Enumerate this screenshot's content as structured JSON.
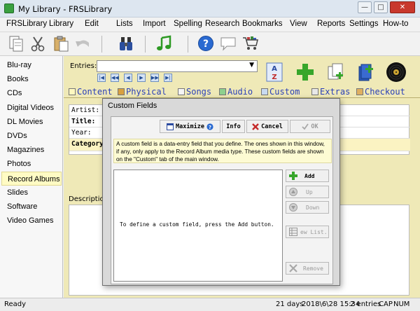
{
  "window": {
    "title": "My Library - FRSLibrary",
    "min": "—",
    "max": "□",
    "close": "✕"
  },
  "menu": [
    "FRSLibrary",
    "Library",
    "Edit",
    "Lists",
    "Import",
    "Spelling",
    "Research",
    "Bookmarks",
    "View",
    "Reports",
    "Settings",
    "How-to"
  ],
  "toolbar": [
    "paste-page-icon",
    "scissors-icon",
    "clipboard-icon",
    "undo-icon",
    "binoculars-icon",
    "music-note-icon",
    "help-icon",
    "speech-bubble-icon",
    "shopping-cart-icon"
  ],
  "sidebar": {
    "items": [
      "Blu-ray",
      "Books",
      "CDs",
      "Digital Videos",
      "DL Movies",
      "DVDs",
      "Magazines",
      "Photos",
      "Record Albums",
      "Slides",
      "Software",
      "Video Games"
    ],
    "active_index": 8
  },
  "entries": {
    "label": "Entries:",
    "value": ""
  },
  "tabs": [
    "Content",
    "Physical",
    "Songs",
    "Audio",
    "Custom",
    "Extras",
    "Checkout"
  ],
  "fields": [
    "Artist:",
    "Title:",
    "Year:",
    "Category:"
  ],
  "description_label": "Description:",
  "dialog": {
    "title": "Custom Fields",
    "maximize": "Maximize",
    "info": "Info",
    "cancel": "Cancel",
    "ok": "OK",
    "info_text": "A custom field is a data-entry field that you define. The ones shown in this window, if any, only apply to the Record Album media type. These custom fields are shown on the \"Custom\" tab of the main window.",
    "empty_message": "To define a custom field, press the Add button.",
    "add": "Add",
    "up": "Up",
    "down": "Down",
    "view_list": "ew List.",
    "remove": "Remove"
  },
  "status": {
    "left": "Ready",
    "days": "21 days",
    "datetime": "2018\\6\\28 15:34",
    "entries": "2 entries",
    "cap": "CAP",
    "num": "NUM"
  },
  "colors": {
    "accent_blue": "#2a3fb8",
    "main_bg": "#efe9b7",
    "active_item": "#fffbc4"
  }
}
